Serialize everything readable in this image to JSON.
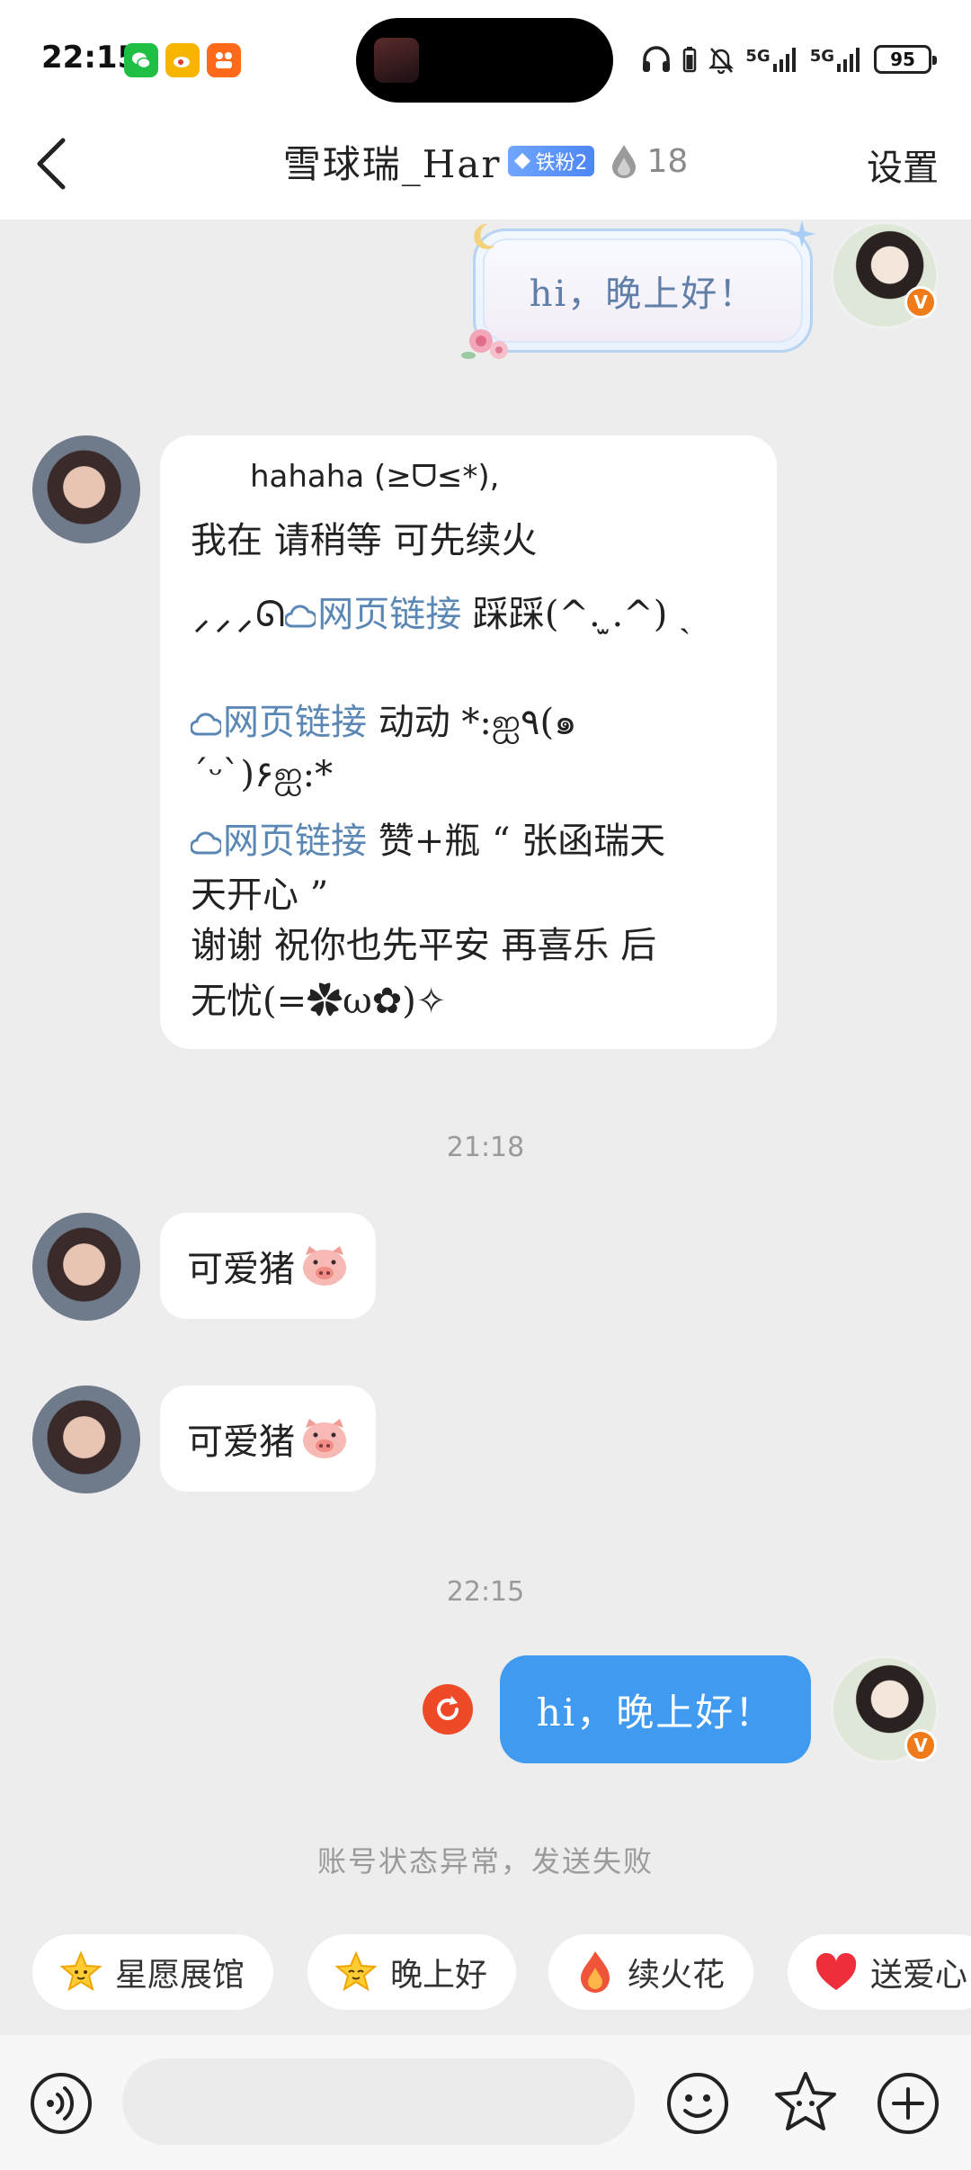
{
  "status_bar": {
    "time": "22:15",
    "network_1": "5G",
    "network_2": "5G",
    "battery": "95"
  },
  "header": {
    "title": "雪球瑞_Har",
    "fan_badge": "铁粉2",
    "fire_count": "18",
    "settings_label": "设置"
  },
  "messages": {
    "deco_bubble_text": "hi，晚上好！",
    "long_bubble": {
      "line1": "hahaha (≥ᗜ≤*),",
      "line2": "我在 请稍等  可先续火",
      "line3_prefix": "⸝⸝⸝ᘏ",
      "line3_link": "网页链接",
      "line3_suffix": " 踩踩(^. ̫.^) ˎ",
      "line4_link": "网页链接",
      "line4_suffix": " 动动 *:ஐ٩(๑",
      "line5": "´ᵕ`)۶ஐ:*",
      "line6_link": "网页链接",
      "line6_suffix": " 赞+瓶 “ 张函瑞天",
      "line7": "天开心 ”",
      "line8": " 谢谢 祝你也先平安 再喜乐 后",
      "line9": "无忧(=✿ω✿)✧"
    },
    "timestamp_1": "21:18",
    "msg_pig_1": "可爱猪",
    "msg_pig_2": "可爱猪",
    "timestamp_2": "22:15",
    "sent_failed_text": "hi，晚上好！",
    "fail_notice": "账号状态异常，发送失败"
  },
  "quick_chips": [
    {
      "label": "星愿展馆",
      "icon": "star-face-icon"
    },
    {
      "label": "晚上好",
      "icon": "star-face-icon"
    },
    {
      "label": "续火花",
      "icon": "flame-icon"
    },
    {
      "label": "送爱心",
      "icon": "heart-icon"
    }
  ],
  "input_bar": {
    "placeholder": ""
  },
  "colors": {
    "background": "#ededed",
    "sent_bubble": "#3f9af0",
    "link": "#5b87b5",
    "error": "#ef4a28",
    "verified_badge": "#f07b1b"
  }
}
